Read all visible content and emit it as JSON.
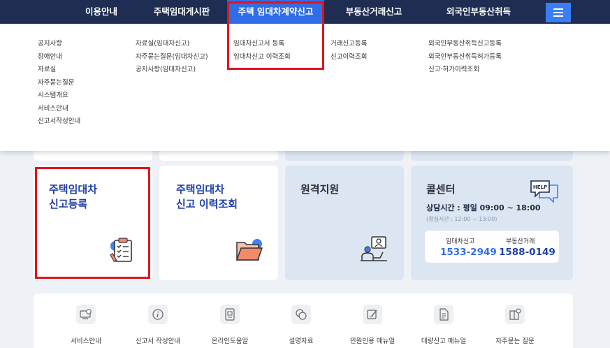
{
  "nav": {
    "items": [
      {
        "label": "이용안내"
      },
      {
        "label": "주택임대게시판"
      },
      {
        "label": "주택 임대차계약신고"
      },
      {
        "label": "부동산거래신고"
      },
      {
        "label": "외국인부동산취득"
      }
    ],
    "menu_icon": "hamburger-icon"
  },
  "mega": {
    "col1": [
      "공지사항",
      "장애안내",
      "자료실",
      "자주묻는질문",
      "시스템개요",
      "서비스안내",
      "신고서작성안내"
    ],
    "col2": [
      "자료실(임대차신고)",
      "자주묻는질문(임대차신고)",
      "공지사항(임대차신고)"
    ],
    "col3": [
      "임대차신고서 등록",
      "임대차신고 이력조회"
    ],
    "col4": [
      "거래신고등록",
      "신고이력조회"
    ],
    "col5": [
      "외국인부동산취득신고등록",
      "외국인부동산취득허가등록",
      "신고·허가이력조회"
    ]
  },
  "cards": {
    "register_title": "주택임대차\n신고등록",
    "history_title": "주택임대차\n신고 이력조회",
    "remote_title": "원격지원",
    "callcenter": {
      "title": "콜센터",
      "help_badge": "HELP",
      "hours": "상담시간 : 평일 09:00 ~ 18:00",
      "lunch": "(점심시간 : 12:00 ~ 13:00)",
      "lease_label": "임대차신고",
      "lease_phone": "1533-2949",
      "trade_label": "부동산거래",
      "trade_phone": "1588-0149"
    }
  },
  "utilities": [
    {
      "label": "서비스안내",
      "icon": "monitor-chat-icon"
    },
    {
      "label": "신고서 작성안내",
      "icon": "info-icon"
    },
    {
      "label": "온라인도움말",
      "icon": "tablet-help-icon"
    },
    {
      "label": "설명자료",
      "icon": "speech-bubbles-icon"
    },
    {
      "label": "민원인용 매뉴얼",
      "icon": "pencil-note-icon"
    },
    {
      "label": "대량신고 매뉴얼",
      "icon": "document-icon"
    },
    {
      "label": "자주묻는 질문",
      "icon": "book-question-icon"
    }
  ],
  "colors": {
    "nav_bg": "#1f2d52",
    "nav_active": "#2f6ee8",
    "highlight": "#e0141c",
    "title_blue": "#1e3fa8",
    "lease_phone": "#2f6ee8",
    "trade_phone": "#1e3fa8"
  }
}
